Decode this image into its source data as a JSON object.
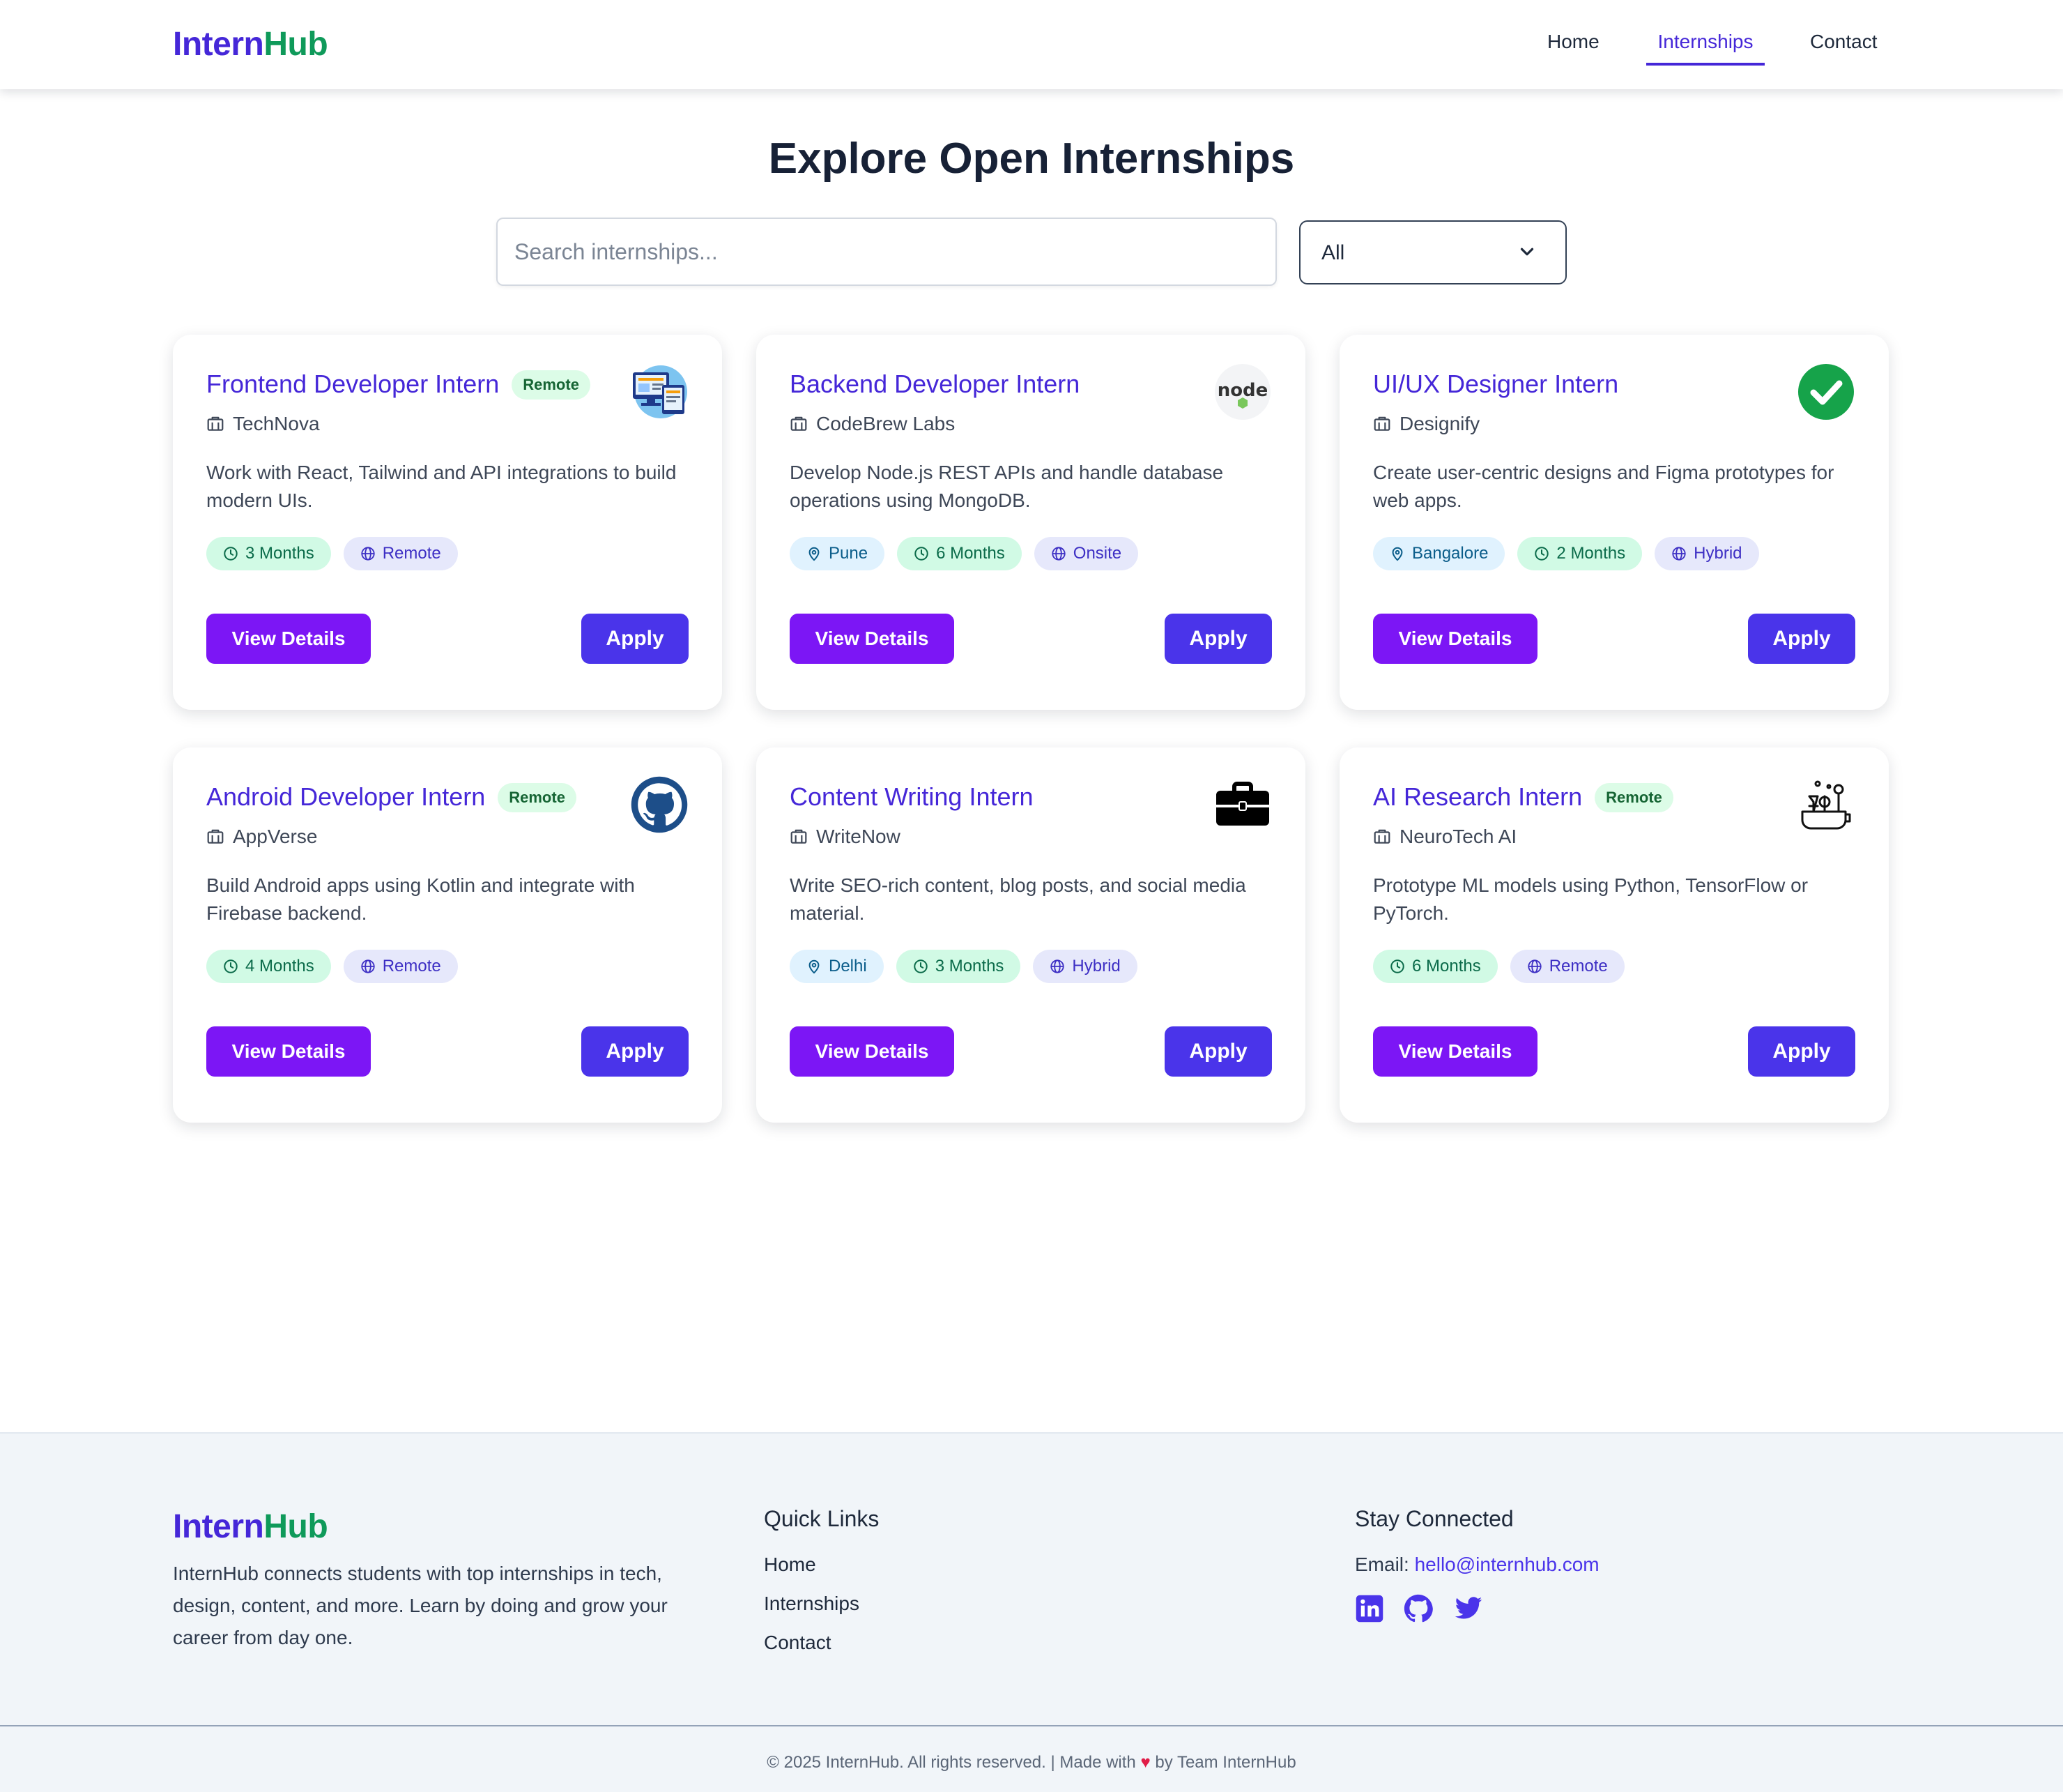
{
  "brand": {
    "part1": "Intern",
    "part2": "Hub"
  },
  "nav": {
    "home": "Home",
    "internships": "Internships",
    "contact": "Contact"
  },
  "page": {
    "title": "Explore Open Internships"
  },
  "search": {
    "placeholder": "Search internships..."
  },
  "filter": {
    "selected": "All"
  },
  "labels": {
    "view_details": "View Details",
    "apply": "Apply",
    "remote_badge": "Remote"
  },
  "cards": [
    {
      "title": "Frontend Developer Intern",
      "company": "TechNova",
      "remote_badge": true,
      "logo": "monitor-devices-icon",
      "desc": "Work with React, Tailwind and API integrations to build modern UIs.",
      "tags": [
        {
          "type": "duration",
          "text": "3 Months"
        },
        {
          "type": "mode",
          "text": "Remote"
        }
      ]
    },
    {
      "title": "Backend Developer Intern",
      "company": "CodeBrew Labs",
      "remote_badge": false,
      "logo": "nodejs-logo-icon",
      "desc": "Develop Node.js REST APIs and handle database operations using MongoDB.",
      "tags": [
        {
          "type": "location",
          "text": "Pune"
        },
        {
          "type": "duration",
          "text": "6 Months"
        },
        {
          "type": "mode",
          "text": "Onsite"
        }
      ]
    },
    {
      "title": "UI/UX Designer Intern",
      "company": "Designify",
      "remote_badge": false,
      "logo": "green-check-icon",
      "desc": "Create user-centric designs and Figma prototypes for web apps.",
      "tags": [
        {
          "type": "location",
          "text": "Bangalore"
        },
        {
          "type": "duration",
          "text": "2 Months"
        },
        {
          "type": "mode",
          "text": "Hybrid"
        }
      ]
    },
    {
      "title": "Android Developer Intern",
      "company": "AppVerse",
      "remote_badge": true,
      "logo": "github-logo-icon",
      "desc": "Build Android apps using Kotlin and integrate with Firebase backend.",
      "tags": [
        {
          "type": "duration",
          "text": "4 Months"
        },
        {
          "type": "mode",
          "text": "Remote"
        }
      ]
    },
    {
      "title": "Content Writing Intern",
      "company": "WriteNow",
      "remote_badge": false,
      "logo": "briefcase-icon",
      "desc": "Write SEO-rich content, blog posts, and social media material.",
      "tags": [
        {
          "type": "location",
          "text": "Delhi"
        },
        {
          "type": "duration",
          "text": "3 Months"
        },
        {
          "type": "mode",
          "text": "Hybrid"
        }
      ]
    },
    {
      "title": "AI Research Intern",
      "company": "NeuroTech AI",
      "remote_badge": true,
      "logo": "lab-flask-icon",
      "desc": "Prototype ML models using Python, TensorFlow or PyTorch.",
      "tags": [
        {
          "type": "duration",
          "text": "6 Months"
        },
        {
          "type": "mode",
          "text": "Remote"
        }
      ]
    }
  ],
  "footer": {
    "about": "InternHub connects students with top internships in tech, design, content, and more. Learn by doing and grow your career from day one.",
    "quick_links_title": "Quick Links",
    "quick_links": [
      "Home",
      "Internships",
      "Contact"
    ],
    "connect_title": "Stay Connected",
    "email_label": "Email: ",
    "email": "hello@internhub.com",
    "social": [
      "linkedin-icon",
      "github-icon",
      "twitter-icon"
    ],
    "copyright_before": "© 2025 InternHub. All rights reserved. | Made with ",
    "heart": "♥",
    "copyright_after": " by Team InternHub"
  },
  "colors": {
    "brand_purple": "#4527d8",
    "brand_green": "#0f9a5a",
    "details_button": "#7c16f5",
    "apply_button": "#4a34ea"
  }
}
